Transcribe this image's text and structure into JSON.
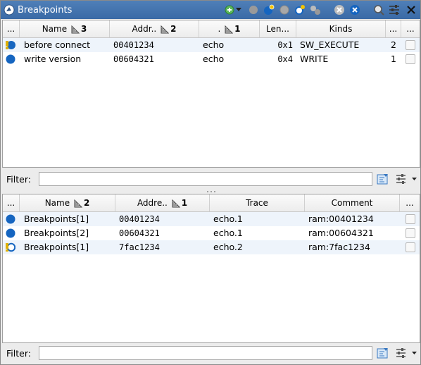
{
  "window": {
    "title": "Breakpoints"
  },
  "toolbar": {
    "buttons": [
      "add-breakpoint",
      "add-dropdown",
      "disable",
      "enable",
      "disable-all",
      "enable-all",
      "make-breakpoints",
      "clear",
      "delete",
      "filter-view",
      "configure",
      "close"
    ]
  },
  "breakpoints_table": {
    "columns": [
      {
        "label": "...",
        "sort": ""
      },
      {
        "label": "Name",
        "sort": "3"
      },
      {
        "label": "Addr..",
        "sort": "2"
      },
      {
        "label": ".",
        "sort": "1"
      },
      {
        "label": "Len...",
        "sort": ""
      },
      {
        "label": "Kinds",
        "sort": ""
      },
      {
        "label": "...",
        "sort": ""
      },
      {
        "label": "...",
        "sort": ""
      }
    ],
    "rows": [
      {
        "name": "before connect",
        "address": "00401234",
        "image": "echo",
        "length": "0x1",
        "kinds": "SW_EXECUTE",
        "count": "2",
        "icon": "breakpoint-warning-icon",
        "enabled": false
      },
      {
        "name": "write version",
        "address": "00604321",
        "image": "echo",
        "length": "0x4",
        "kinds": "WRITE",
        "count": "1",
        "icon": "breakpoint-enabled-icon",
        "enabled": false
      }
    ]
  },
  "filter_top": {
    "label": "Filter:",
    "value": "",
    "placeholder": ""
  },
  "locations_table": {
    "columns": [
      {
        "label": "...",
        "sort": ""
      },
      {
        "label": "Name",
        "sort": "2"
      },
      {
        "label": "Addre..",
        "sort": "1"
      },
      {
        "label": "Trace",
        "sort": ""
      },
      {
        "label": "Comment",
        "sort": ""
      },
      {
        "label": "...",
        "sort": ""
      }
    ],
    "rows": [
      {
        "name": "Breakpoints[1]",
        "address": "00401234",
        "trace": "echo.1",
        "comment": "ram:00401234",
        "icon": "breakpoint-enabled-icon"
      },
      {
        "name": "Breakpoints[2]",
        "address": "00604321",
        "trace": "echo.1",
        "comment": "ram:00604321",
        "icon": "breakpoint-enabled-icon"
      },
      {
        "name": "Breakpoints[1]",
        "address": "7fac1234",
        "trace": "echo.2",
        "comment": "ram:7fac1234",
        "icon": "breakpoint-warning-outline-icon"
      }
    ]
  },
  "filter_bottom": {
    "label": "Filter:",
    "value": "",
    "placeholder": ""
  },
  "colors": {
    "title_bar": "#3f70ad",
    "breakpoint_blue": "#1565c0",
    "warning_yellow": "#e0b000",
    "row_alt": "#eef4fb"
  }
}
